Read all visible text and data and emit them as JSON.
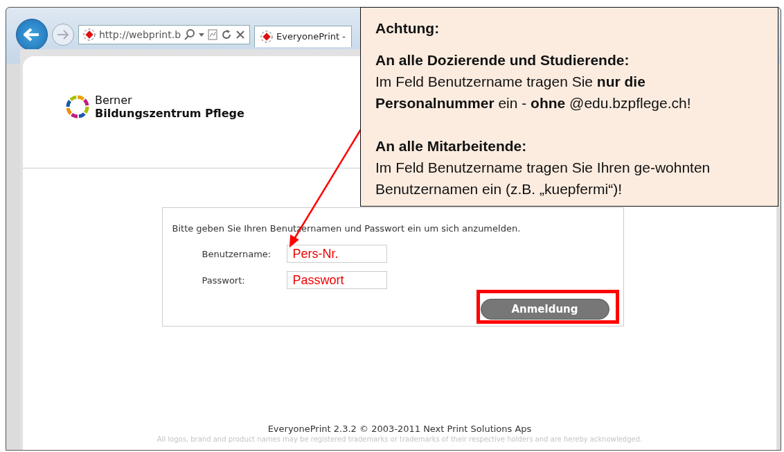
{
  "browser": {
    "address": "http://webprint.b",
    "tab": {
      "title": "EveryonePrint -"
    }
  },
  "page": {
    "logo": {
      "line1": "Berner",
      "line2": "Bildungszentrum Pflege"
    },
    "login": {
      "instruction": "Bitte geben Sie Ihren Benutzernamen und Passwort ein um sich anzumelden.",
      "fields": [
        {
          "label": "Benutzername:",
          "value": "Pers-Nr."
        },
        {
          "label": "Passwort:",
          "value": "Passwort"
        }
      ],
      "button": "Anmeldung"
    },
    "footer": {
      "copyright": "EveryonePrint 2.3.2 © 2003-2011 Next Print Solutions Aps",
      "disclaimer": "All logos, brand and product names may be registered trademarks or trademarks of their respective holders and are hereby acknowledged."
    }
  },
  "callout": {
    "title": "Achtung:",
    "sections": [
      {
        "heading": "An alle Dozierende und Studierende:",
        "text": "Im Feld Benutzername tragen Sie **nur die Personalnummer** ein - **ohne** @edu.bzpflege.ch!"
      },
      {
        "heading": "An alle Mitarbeitende:",
        "text": "Im Feld Benutzername tragen Sie Ihren ge-wohnten Benutzernamen ein (z.B. „kuepfermi“)!"
      }
    ]
  }
}
